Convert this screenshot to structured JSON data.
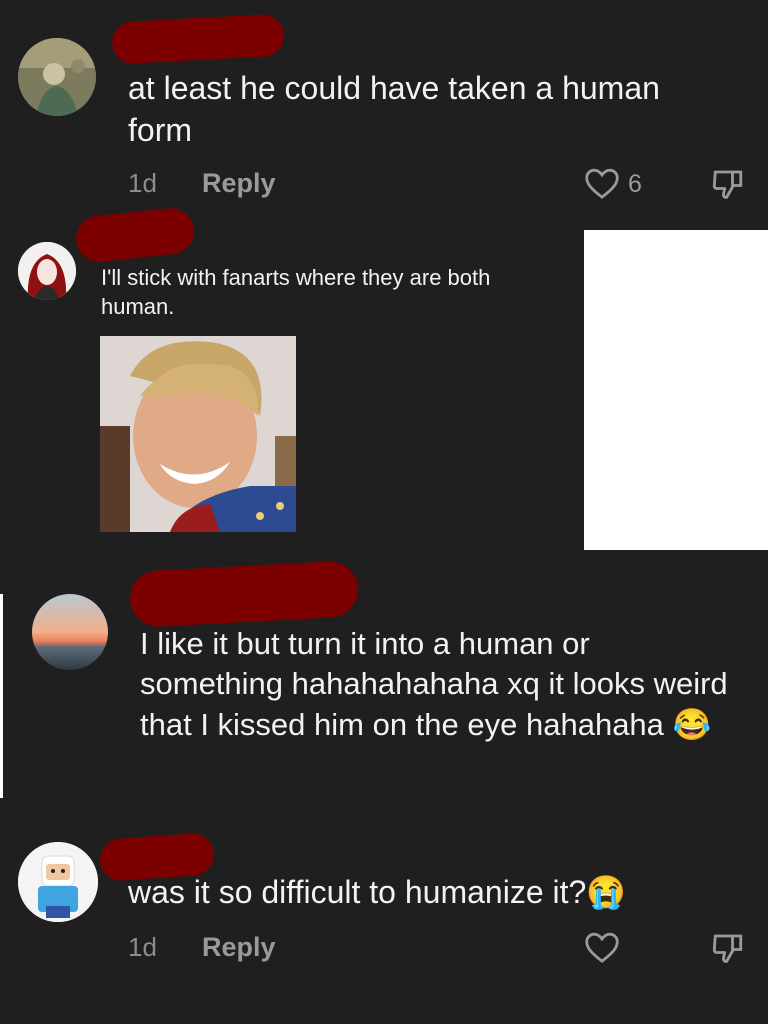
{
  "comments": [
    {
      "text": "at least he could have taken a human form",
      "time": "1d",
      "reply_label": "Reply",
      "like_count": "6"
    },
    {
      "text": "I'll stick with fanarts where they are both human."
    },
    {
      "text": "I like it but turn it into a human or something hahahahahaha xq it looks weird that I kissed him on the eye hahahaha 😂"
    },
    {
      "text": "was it so difficult to humanize it?😭",
      "time": "1d",
      "reply_label": "Reply"
    }
  ],
  "colors": {
    "background": "#1f1f1f",
    "redaction": "#7d0000",
    "muted_text": "#8c8c8c"
  }
}
